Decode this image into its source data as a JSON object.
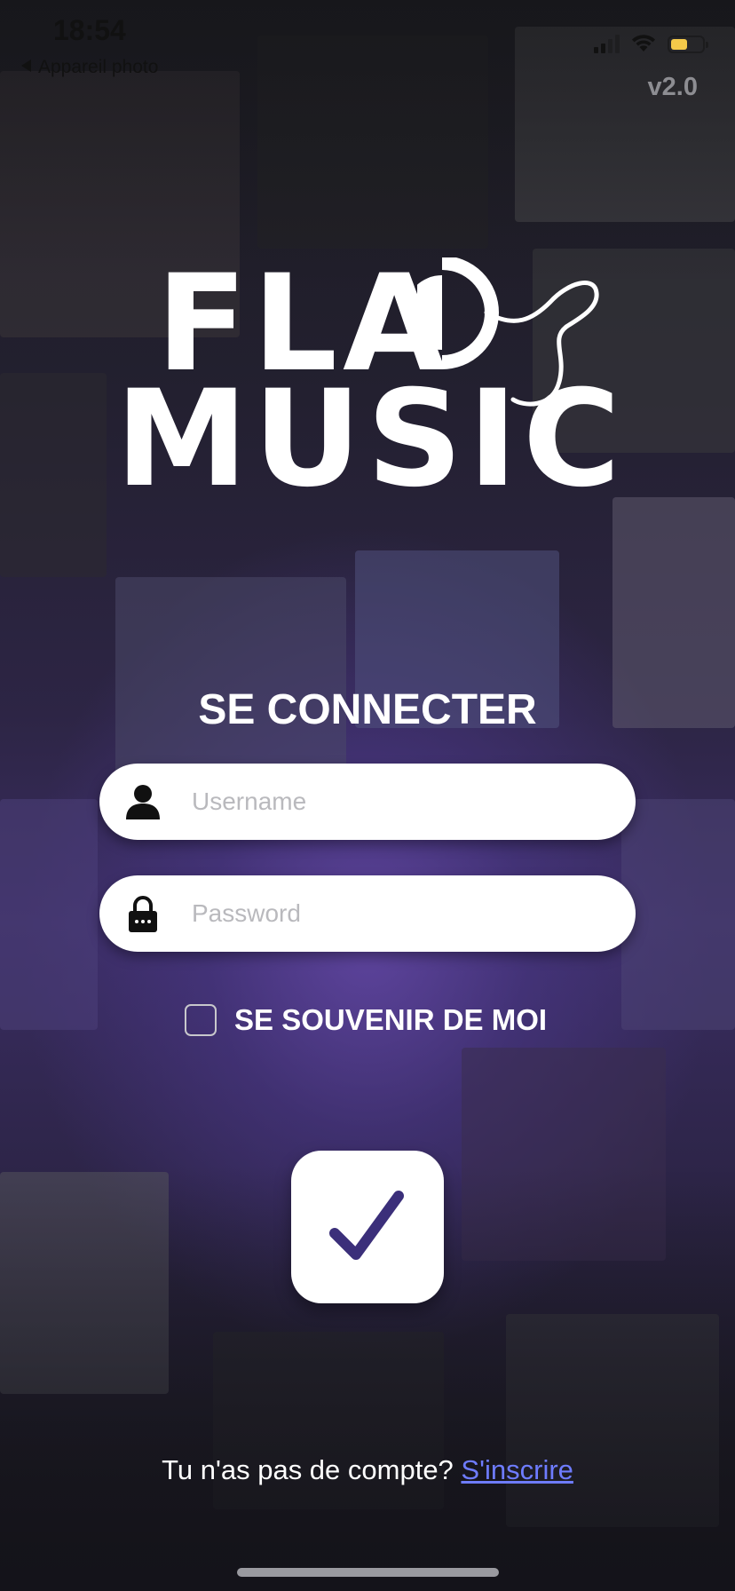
{
  "status_bar": {
    "time": "18:54",
    "back_label": "Appareil photo",
    "signal_icon": "signal-icon",
    "wifi_icon": "wifi-icon",
    "battery_icon": "battery-icon",
    "battery_color": "#f3c94a"
  },
  "app": {
    "version": "v2.0",
    "logo_line1": "FLAD",
    "logo_line2": "MUSIC"
  },
  "login": {
    "title": "SE CONNECTER",
    "username_placeholder": "Username",
    "username_value": "",
    "username_icon": "user-icon",
    "password_placeholder": "Password",
    "password_value": "",
    "password_icon": "lock-icon",
    "remember_label": "SE SOUVENIR DE MOI",
    "remember_checked": false,
    "submit_icon": "checkmark-icon",
    "accent_color": "#3b2f7a"
  },
  "signup": {
    "prompt": "Tu n'as pas de compte? ",
    "link_label": "S'inscrire",
    "link_color": "#6e7cff"
  }
}
